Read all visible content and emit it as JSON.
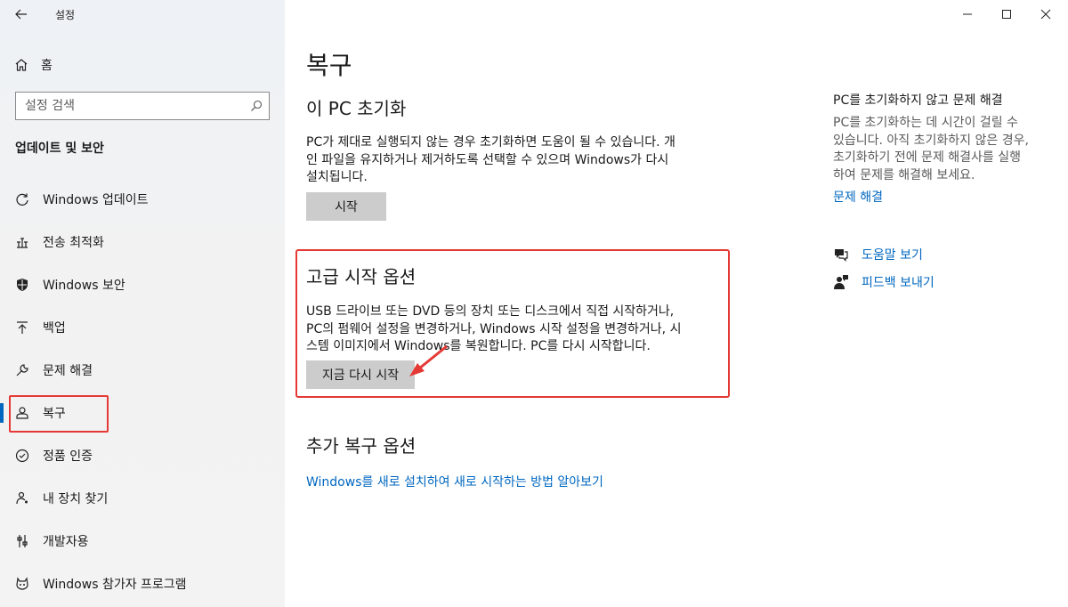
{
  "titlebar": {
    "app_title": "설정"
  },
  "sidebar": {
    "home_label": "홈",
    "search_placeholder": "설정 검색",
    "section_title": "업데이트 및 보안",
    "items": [
      {
        "label": "Windows 업데이트",
        "icon": "refresh-icon"
      },
      {
        "label": "전송 최적화",
        "icon": "delivery-icon"
      },
      {
        "label": "Windows 보안",
        "icon": "shield-icon"
      },
      {
        "label": "백업",
        "icon": "upload-icon"
      },
      {
        "label": "문제 해결",
        "icon": "wrench-icon"
      },
      {
        "label": "복구",
        "icon": "recovery-icon",
        "active": true
      },
      {
        "label": "정품 인증",
        "icon": "check-circle-icon"
      },
      {
        "label": "내 장치 찾기",
        "icon": "person-pin-icon"
      },
      {
        "label": "개발자용",
        "icon": "developer-icon"
      },
      {
        "label": "Windows 참가자 프로그램",
        "icon": "insider-icon"
      }
    ]
  },
  "main": {
    "page_title": "복구",
    "reset": {
      "title": "이 PC 초기화",
      "lines": [
        "PC가 제대로 실행되지 않는 경우 초기화하면 도움이 될 수 있습니다. 개",
        "인 파일을 유지하거나 제거하도록 선택할 수 있으며 Windows가 다시",
        "설치됩니다."
      ],
      "button": "시작"
    },
    "advanced": {
      "title": "고급 시작 옵션",
      "lines": [
        "USB 드라이브 또는 DVD 등의 장치 또는 디스크에서 직접 시작하거나,",
        "PC의 펌웨어 설정을 변경하거나, Windows 시작 설정을 변경하거나, 시",
        "스템 이미지에서 Windows를 복원합니다. PC를 다시 시작합니다."
      ],
      "button": "지금 다시 시작"
    },
    "more": {
      "title": "추가 복구 옵션",
      "link": "Windows를 새로 설치하여 새로 시작하는 방법 알아보기"
    }
  },
  "right": {
    "title": "PC를 초기화하지 않고 문제 해결",
    "lines": [
      "PC를 초기화하는 데 시간이 걸릴 수",
      "있습니다. 아직 초기화하지 않은 경우,",
      "초기화하기 전에 문제 해결사를 실행",
      "하여 문제를 해결해 보세요."
    ],
    "link": "문제 해결",
    "help": "도움말 보기",
    "feedback": "피드백 보내기"
  },
  "colors": {
    "accent": "#0067c0",
    "highlight": "#e53935",
    "button": "#cccccc"
  }
}
